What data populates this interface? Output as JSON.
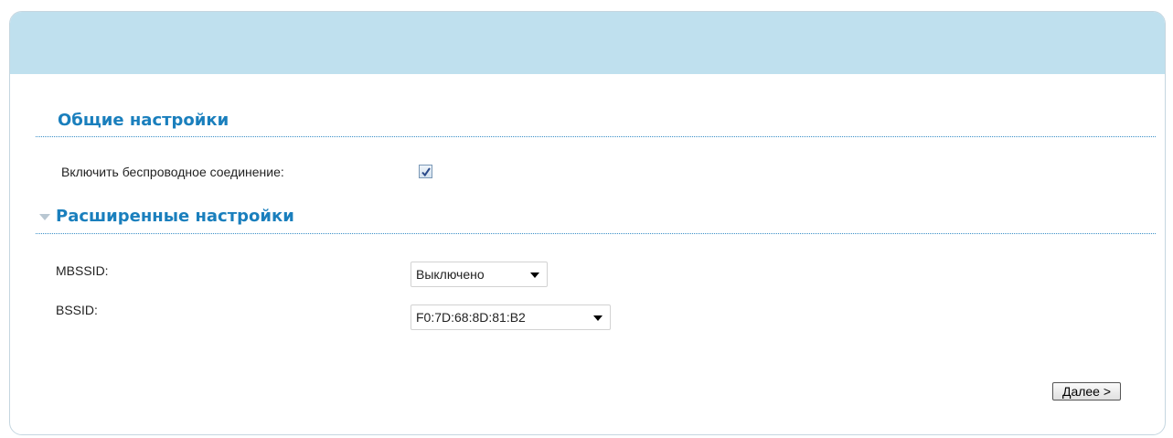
{
  "general": {
    "title": "Общие настройки",
    "enable_wireless_label": "Включить беспроводное соединение:",
    "enable_wireless_checked": true
  },
  "advanced": {
    "title": "Расширенные настройки",
    "mbssid_label": "MBSSID:",
    "mbssid_value": "Выключено",
    "bssid_label": "BSSID:",
    "bssid_value": "F0:7D:68:8D:81:B2"
  },
  "actions": {
    "next_label_first": "Д",
    "next_label_rest": "алее >"
  },
  "colors": {
    "header_bg": "#bfe0ee",
    "section_title": "#1a7fbd"
  }
}
